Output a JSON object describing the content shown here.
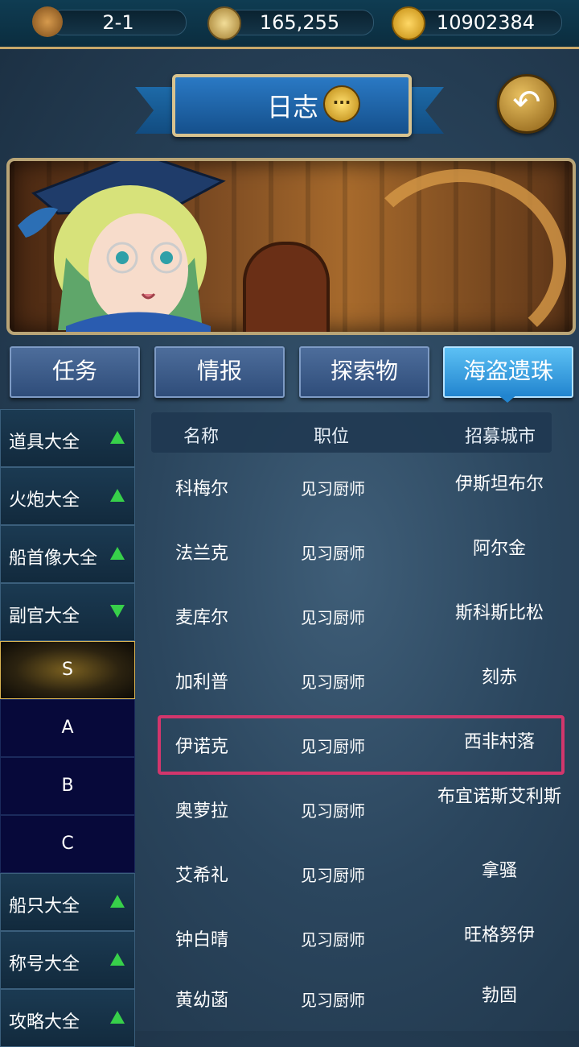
{
  "topbar": {
    "stage": "2-1",
    "compass_value": "165,255",
    "gold_value": "10902384"
  },
  "header": {
    "title": "日志",
    "chat_icon": "chat-bubble-icon",
    "back_icon": "back-arrow-icon"
  },
  "tabs": [
    {
      "label": "任务",
      "active": false
    },
    {
      "label": "情报",
      "active": false
    },
    {
      "label": "探索物",
      "active": false
    },
    {
      "label": "海盗遗珠",
      "active": true
    }
  ],
  "sidebar": {
    "items": [
      {
        "label": "道具大全",
        "arrow": "up"
      },
      {
        "label": "火炮大全",
        "arrow": "up"
      },
      {
        "label": "船首像大全",
        "arrow": "up"
      },
      {
        "label": "副官大全",
        "arrow": "down"
      },
      {
        "label": "船只大全",
        "arrow": "up"
      },
      {
        "label": "称号大全",
        "arrow": "up"
      },
      {
        "label": "攻略大全",
        "arrow": "up"
      }
    ],
    "subitems": [
      {
        "label": "S",
        "selected": true
      },
      {
        "label": "A",
        "selected": false
      },
      {
        "label": "B",
        "selected": false
      },
      {
        "label": "C",
        "selected": false
      }
    ]
  },
  "table": {
    "headers": [
      "名称",
      "职位",
      "招募城市"
    ],
    "rows": [
      [
        "科梅尔",
        "见习厨师",
        "伊斯坦布尔"
      ],
      [
        "法兰克",
        "见习厨师",
        "阿尔金"
      ],
      [
        "麦库尔",
        "见习厨师",
        "斯科斯比松"
      ],
      [
        "加利普",
        "见习厨师",
        "刻赤"
      ],
      [
        "伊诺克",
        "见习厨师",
        "西非村落"
      ],
      [
        "奥萝拉",
        "见习厨师",
        "布宜诺斯艾利斯"
      ],
      [
        "艾希礼",
        "见习厨师",
        "拿骚"
      ],
      [
        "钟白晴",
        "见习厨师",
        "旺格努伊"
      ],
      [
        "黄幼菡",
        "见习厨师",
        "勃固"
      ]
    ]
  },
  "colors": {
    "highlight": "#d2366c",
    "active_tab": "#2285cf",
    "arrow": "#37d04a"
  }
}
